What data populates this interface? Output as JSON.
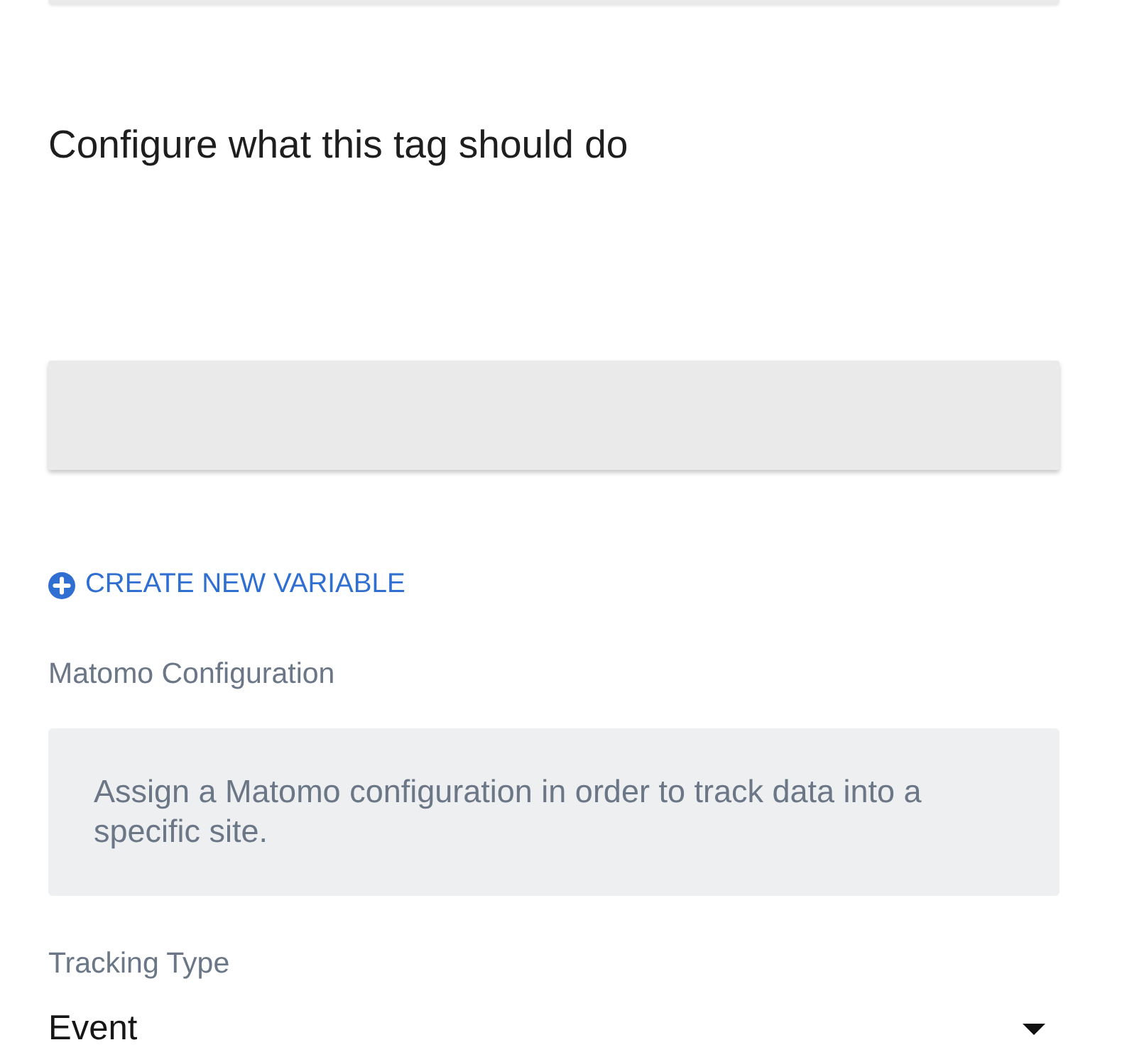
{
  "heading": "Configure what this tag should do",
  "create_variable_link": {
    "label": "CREATE NEW VARIABLE"
  },
  "fields": [
    {
      "kind": "notice",
      "label": "Matomo Configuration",
      "message": "Assign a Matomo configuration in order to track data into a specific site."
    },
    {
      "kind": "select",
      "label": "Tracking Type",
      "value": "Event"
    }
  ]
}
